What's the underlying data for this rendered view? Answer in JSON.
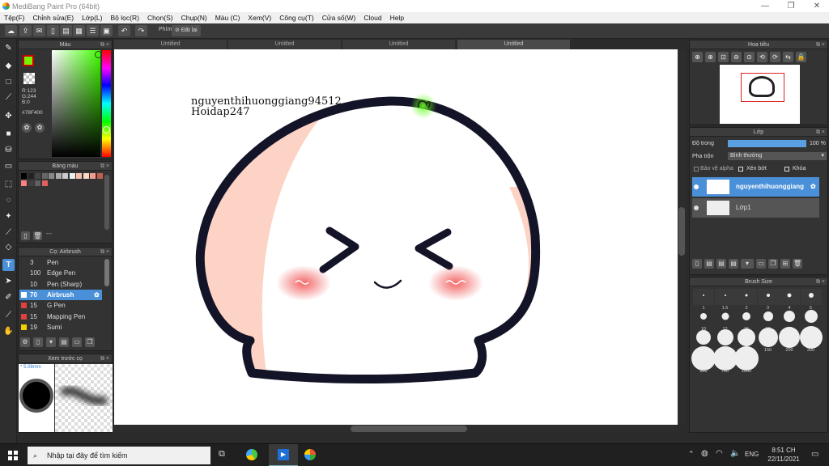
{
  "window": {
    "title": "MediBang Paint Pro (64bit)"
  },
  "menu": [
    "Tệp(F)",
    "Chỉnh sửa(E)",
    "Lớp(L)",
    "Bộ lọc(R)",
    "Chọn(S)",
    "Chụp(N)",
    "Màu (C)",
    "Xem(V)",
    "Công cụ(T)",
    "Cửa số(W)",
    "Cloud",
    "Help"
  ],
  "toolbar": {
    "key_label": "Phím",
    "reset_label": "Đặt lại"
  },
  "color_panel": {
    "title": "Màu",
    "r": "R:123",
    "g": "G:244",
    "b": "B:0",
    "hex": "#78F400",
    "fg": "#78f400"
  },
  "palette_panel": {
    "title": "Bảng màu",
    "value": "---"
  },
  "brush_panel": {
    "title": "Cọ: Airbrush",
    "items": [
      {
        "size": "3",
        "name": "Pen",
        "color": "#333333"
      },
      {
        "size": "100",
        "name": "Edge Pen",
        "color": "#333333"
      },
      {
        "size": "10",
        "name": "Pen (Sharp)",
        "color": "#333333"
      },
      {
        "size": "70",
        "name": "Airbrush",
        "color": "#ffffff"
      },
      {
        "size": "15",
        "name": "G Pen",
        "color": "#e04040"
      },
      {
        "size": "15",
        "name": "Mapping Pen",
        "color": "#e04040"
      },
      {
        "size": "19",
        "name": "Sumi",
        "color": "#f0d000"
      }
    ]
  },
  "brush_preview": {
    "title": "Xem trước cọ",
    "size": "5.08mm"
  },
  "canvas": {
    "tabs": [
      "Untitled",
      "Untitled",
      "Untitled",
      "Untitled"
    ],
    "text1": "nguyenthihuonggiang94512",
    "text2": "Hoidap247"
  },
  "navigator": {
    "title": "Hoa tiêu"
  },
  "layer_panel": {
    "title": "Lớp",
    "opacity_label": "Độ trong",
    "opacity_value": "100 %",
    "opacity_fraction": 1.0,
    "blend_label": "Pha trộn",
    "blend_value": "Bình thường",
    "protect_alpha": "Bảo vệ alpha",
    "clipping": "Xén bớt",
    "lock": "Khóa",
    "layers": [
      {
        "name": "nguyenthihuonggiang"
      },
      {
        "name": "Lớp1"
      }
    ]
  },
  "brush_size_panel": {
    "title": "Brush Size",
    "sizes": [
      "1",
      "1.5",
      "2",
      "3",
      "4",
      "5",
      "10",
      "12",
      "15",
      "20",
      "25",
      "30",
      "50",
      "70",
      "100",
      "150",
      "200",
      "300",
      "500",
      "700",
      "1000"
    ]
  },
  "taskbar": {
    "search": "Nhập tại đây để tìm kiếm",
    "lang": "ENG",
    "time": "8:51 CH",
    "date": "22/11/2021"
  }
}
